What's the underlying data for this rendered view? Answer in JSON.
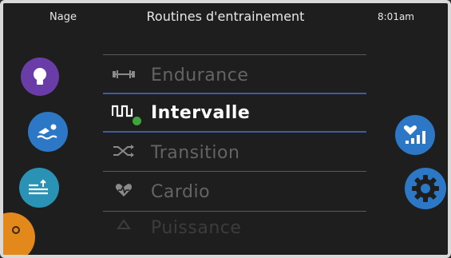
{
  "header": {
    "app": "Nage",
    "title": "Routines d'entrainement",
    "clock": "8:01am"
  },
  "menu": {
    "items": [
      {
        "label": "Endurance",
        "icon": "barbell-icon",
        "state": "normal"
      },
      {
        "label": "Intervalle",
        "icon": "interval-wave-icon",
        "state": "selected"
      },
      {
        "label": "Transition",
        "icon": "shuffle-icon",
        "state": "normal"
      },
      {
        "label": "Cardio",
        "icon": "heart-icon",
        "state": "normal"
      },
      {
        "label": "Puissance",
        "icon": "power-icon",
        "state": "faded"
      }
    ]
  },
  "side_buttons": {
    "left": [
      {
        "name": "lightbulb-icon",
        "color": "#6a3ca8"
      },
      {
        "name": "swimmer-icon",
        "color": "#2d77c7"
      },
      {
        "name": "water-level-icon",
        "color": "#2a93b5"
      },
      {
        "name": "temperature-icon",
        "color": "#e3881b"
      }
    ],
    "right": [
      {
        "name": "heart-stats-icon",
        "color": "#2d77c7"
      },
      {
        "name": "gear-icon",
        "color": "#2d77c7"
      }
    ]
  },
  "colors": {
    "accent_blue": "#2d77c7",
    "selection_line": "#3e5ca6",
    "check_green": "#3ea63a"
  }
}
